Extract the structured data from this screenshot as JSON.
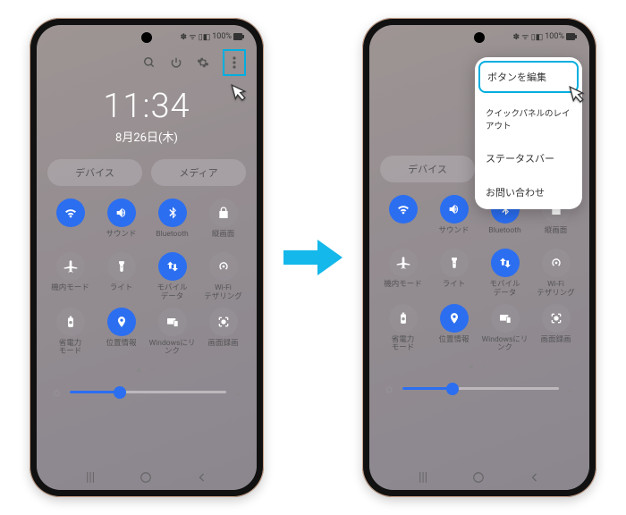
{
  "status": {
    "battery": "100%",
    "icons": "✽ ᯤ ⁴ᴳ ▮◧"
  },
  "clock": {
    "time": "11:34",
    "date": "8月26日(木)"
  },
  "tabs": {
    "device": "デバイス",
    "media": "メディア"
  },
  "tiles": [
    {
      "label": "",
      "icon": "wifi",
      "on": true
    },
    {
      "label": "サウンド",
      "icon": "sound",
      "on": true
    },
    {
      "label": "Bluetooth",
      "icon": "bluetooth",
      "on": true
    },
    {
      "label": "縦画面",
      "icon": "lock",
      "on": false
    },
    {
      "label": "機内モード",
      "icon": "airplane",
      "on": false
    },
    {
      "label": "ライト",
      "icon": "flashlight",
      "on": false
    },
    {
      "label": "モバイル\nデータ",
      "icon": "mobiledata",
      "on": true
    },
    {
      "label": "Wi-Fi\nテザリング",
      "icon": "tether",
      "on": false
    },
    {
      "label": "省電力\nモード",
      "icon": "powersave",
      "on": false
    },
    {
      "label": "位置情報",
      "icon": "location",
      "on": true
    },
    {
      "label": "Windowsにリ\nンク",
      "icon": "link",
      "on": false
    },
    {
      "label": "画面録画",
      "icon": "record",
      "on": false
    }
  ],
  "menu": {
    "edit_buttons": "ボタンを編集",
    "panel_layout": "クイックパネルのレイアウト",
    "status_bar": "ステータスバー",
    "contact": "お問い合わせ"
  },
  "nav": {
    "recent": "|||",
    "home": "○",
    "back": "‹"
  }
}
